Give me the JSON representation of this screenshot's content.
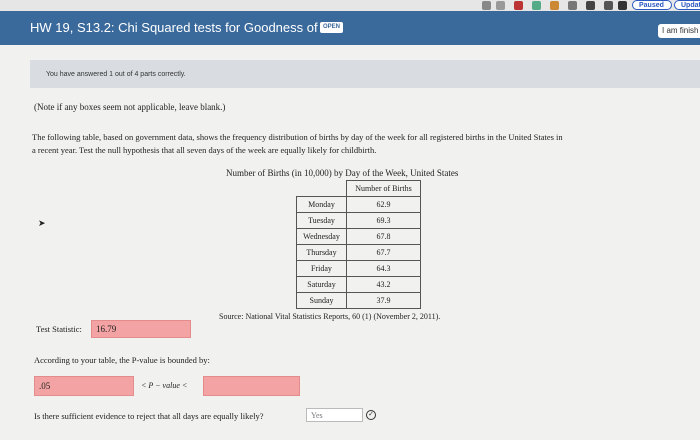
{
  "browser": {
    "paused_label": "Paused",
    "update_label": "Updat"
  },
  "header": {
    "title": "HW 19, S13.2: Chi Squared tests for Goodness of Fit",
    "badge": "OPEN",
    "finish_label": "I am finish"
  },
  "progress": {
    "text": "You have answered 1 out of 4 parts correctly."
  },
  "question": {
    "note": "(Note if any boxes seem not applicable, leave blank.)",
    "para_line1": "The following table, based on government data, shows the frequency distribution of births by day of the week for all registered births in the United States in",
    "para_line2": "a recent year. Test the null hypothesis that all seven days of the week are equally likely for childbirth.",
    "table_title": "Number of Births (in 10,000) by Day of the Week, United States",
    "table_header": "Number of Births",
    "rows": [
      {
        "day": "Monday",
        "value": "62.9"
      },
      {
        "day": "Tuesday",
        "value": "69.3"
      },
      {
        "day": "Wednesday",
        "value": "67.8"
      },
      {
        "day": "Thursday",
        "value": "67.7"
      },
      {
        "day": "Friday",
        "value": "64.3"
      },
      {
        "day": "Saturday",
        "value": "43.2"
      },
      {
        "day": "Sunday",
        "value": "37.9"
      }
    ],
    "source": "Source: National Vital Statistics Reports, 60 (1) (November 2, 2011)."
  },
  "answers": {
    "test_statistic_label": "Test Statistic:",
    "test_statistic_value": "16.79",
    "bounded_text": "According to your table, the P-value is bounded by:",
    "pvalue_low": ".05",
    "pvalue_mid": "< P − value <",
    "pvalue_high": "",
    "reject_question": "Is there sufficient evidence to reject that all days are equally likely?",
    "reject_value": "Yes"
  }
}
